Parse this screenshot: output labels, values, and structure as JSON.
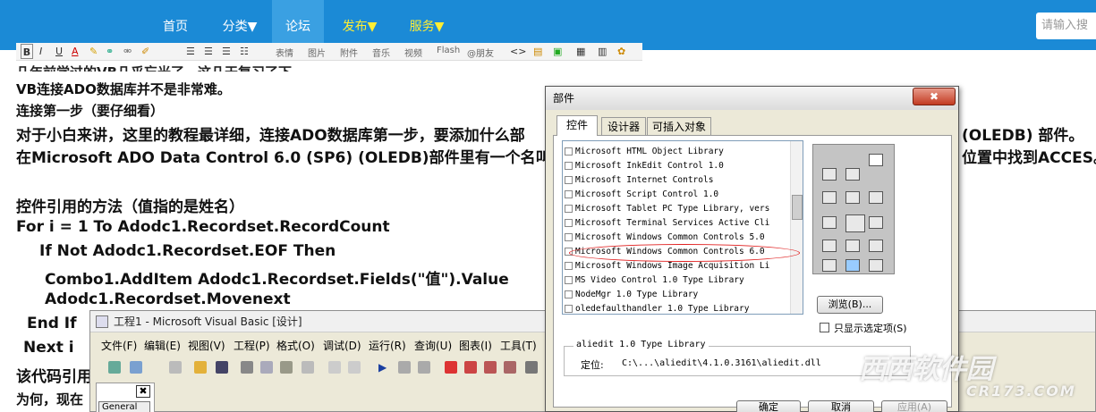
{
  "nav": {
    "items": [
      {
        "label": "首页"
      },
      {
        "label": "分类▼"
      },
      {
        "label": "论坛"
      },
      {
        "label": "发布▼"
      },
      {
        "label": "服务▼"
      }
    ],
    "search_placeholder": "请输入搜"
  },
  "editor_toolbar": {
    "bold": "B",
    "italic": "I",
    "underline": "U",
    "font_color": "A",
    "labels": [
      "表情",
      "图片",
      "附件",
      "音乐",
      "视频",
      "Flash",
      "@朋友"
    ]
  },
  "article": {
    "lines": [
      "VB连接ADO数据库并不是非常难。",
      "连接第一步（要仔细看）",
      "对于小白来讲，这里的教程最详细，连接ADO数据库第一步，要添加什么部",
      "在Microsoft ADO Data Control 6.0 (SP6) (OLEDB)部件里有一个名叫",
      "控件引用的方法（值指的是姓名）",
      "For i = 1 To Adodc1.Recordset.RecordCount",
      "If Not Adodc1.Recordset.EOF Then",
      "Combo1.AddItem Adodc1.Recordset.Fields(\"值\").Value",
      "Adodc1.Recordset.Movenext",
      "End If",
      "Next i",
      "该代码引用",
      "为何，现在"
    ],
    "right_fragments": [
      "(OLEDB) 部件。",
      "位置中找到ACCES。"
    ]
  },
  "vb_ide": {
    "title": "工程1 - Microsoft Visual Basic [设计]",
    "menu": [
      "文件(F)",
      "编辑(E)",
      "视图(V)",
      "工程(P)",
      "格式(O)",
      "调试(D)",
      "运行(R)",
      "查询(U)",
      "图表(I)",
      "工具(T)"
    ],
    "panel_close": "✖",
    "panel_tab": "General"
  },
  "dialog": {
    "title": "部件",
    "close": "✖",
    "tabs": [
      "控件",
      "设计器",
      "可插入对象"
    ],
    "items": [
      "Microsoft HTML Object Library",
      "Microsoft InkEdit Control 1.0",
      "Microsoft Internet Controls",
      "Microsoft Script Control 1.0",
      "Microsoft Tablet PC Type Library, vers",
      "Microsoft Terminal Services Active Cli",
      "Microsoft Windows Common Controls 5.0",
      "Microsoft Windows Common Controls 6.0",
      "Microsoft Windows Image Acquisition Li",
      "MS Video Control 1.0 Type Library",
      "NodeMgr 1.0 Type Library",
      "oledefaulthandler 1.0 Type Library"
    ],
    "browse_label": "浏览(B)...",
    "only_selected_label": "只显示选定项(S)",
    "group_title": "aliedit 1.0 Type Library",
    "location_label": "定位:",
    "location_value": "C:\\...\\aliedit\\4.1.0.3161\\aliedit.dll",
    "ok_label": "确定",
    "cancel_label": "取消",
    "apply_label": "应用(A)"
  },
  "watermark": {
    "main": "西西软件园",
    "sub": "CR173.COM"
  }
}
